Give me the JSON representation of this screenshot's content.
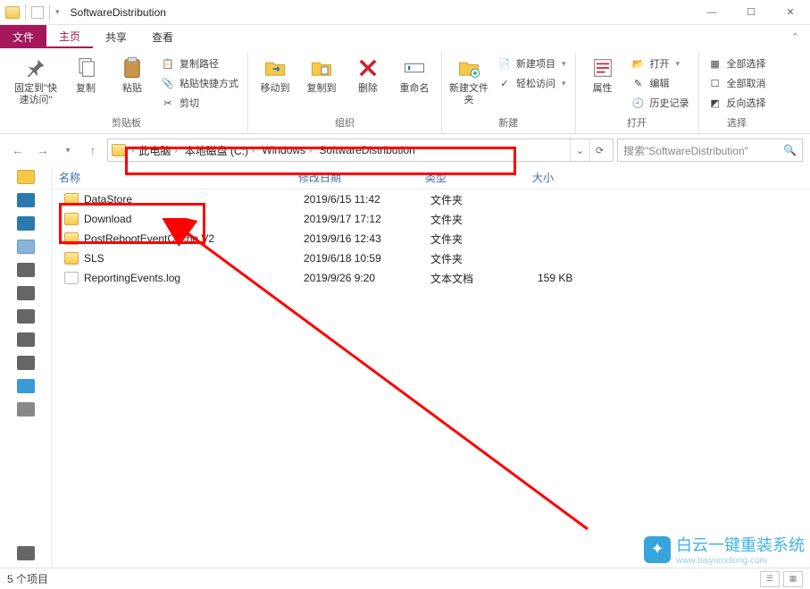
{
  "title": "SoftwareDistribution",
  "tabs": {
    "file": "文件",
    "home": "主页",
    "share": "共享",
    "view": "查看"
  },
  "ribbon": {
    "pin": "固定到\"快速访问\"",
    "copy": "复制",
    "paste": "粘贴",
    "copy_path": "复制路径",
    "paste_shortcut": "粘贴快捷方式",
    "cut": "剪切",
    "clipboard": "剪贴板",
    "move_to": "移动到",
    "copy_to": "复制到",
    "delete": "删除",
    "rename": "重命名",
    "organize": "组织",
    "new_folder": "新建文件夹",
    "new_item": "新建项目",
    "easy_access": "轻松访问",
    "new": "新建",
    "properties": "属性",
    "open": "打开",
    "edit": "编辑",
    "history": "历史记录",
    "open_group": "打开",
    "select_all": "全部选择",
    "select_none": "全部取消",
    "invert": "反向选择",
    "select": "选择"
  },
  "breadcrumb": [
    "此电脑",
    "本地磁盘 (C:)",
    "Windows",
    "SoftwareDistribution"
  ],
  "search_placeholder": "搜索\"SoftwareDistribution\"",
  "columns": {
    "name": "名称",
    "date": "修改日期",
    "type": "类型",
    "size": "大小"
  },
  "rows": [
    {
      "icon": "folder",
      "name": "DataStore",
      "date": "2019/6/15 11:42",
      "type": "文件夹",
      "size": ""
    },
    {
      "icon": "folder",
      "name": "Download",
      "date": "2019/9/17 17:12",
      "type": "文件夹",
      "size": ""
    },
    {
      "icon": "folder",
      "name": "PostRebootEventCache.V2",
      "date": "2019/9/16 12:43",
      "type": "文件夹",
      "size": ""
    },
    {
      "icon": "folder",
      "name": "SLS",
      "date": "2019/6/18 10:59",
      "type": "文件夹",
      "size": ""
    },
    {
      "icon": "file",
      "name": "ReportingEvents.log",
      "date": "2019/9/26 9:20",
      "type": "文本文档",
      "size": "159 KB"
    }
  ],
  "status": "5 个项目",
  "watermark": {
    "main": "白云一键重装系统",
    "sub": "www.baiyunxitong.com"
  }
}
